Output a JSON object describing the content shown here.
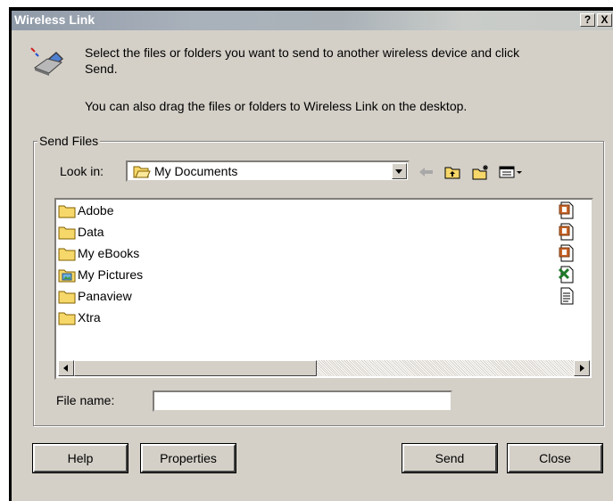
{
  "window": {
    "title": "Wireless Link",
    "help_btn": "?",
    "close_btn": "X"
  },
  "intro": {
    "line1": "Select the files or folders you want to send to another wireless device and click",
    "line2": "Send.",
    "line3": "You can also drag the files or folders to Wireless Link on the desktop."
  },
  "group": {
    "legend": "Send Files",
    "look_in_label": "Look in:",
    "look_in_value": "My Documents",
    "file_name_label": "File name:",
    "file_name_value": ""
  },
  "files": [
    {
      "label": "Adobe",
      "icon": "folder-icon"
    },
    {
      "label": "Data",
      "icon": "folder-icon"
    },
    {
      "label": "My eBooks",
      "icon": "folder-icon"
    },
    {
      "label": "My Pictures",
      "icon": "pictures-folder-icon"
    },
    {
      "label": "Panaview",
      "icon": "folder-icon"
    },
    {
      "label": "Xtra",
      "icon": "folder-icon"
    }
  ],
  "side_icons": [
    "powerpoint-file-icon",
    "powerpoint-file-icon",
    "powerpoint-file-icon",
    "excel-file-icon",
    "text-file-icon"
  ],
  "buttons": {
    "help": "Help",
    "properties": "Properties",
    "send": "Send",
    "close": "Close"
  },
  "colors": {
    "dialog_face": "#d4d0c8",
    "folder_yellow": "#f6d769",
    "title_text": "#ffffff"
  }
}
